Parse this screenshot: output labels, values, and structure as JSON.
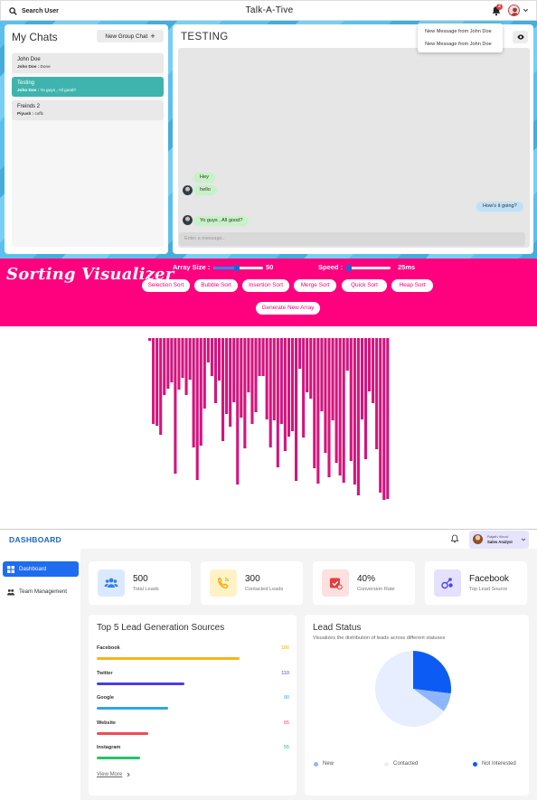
{
  "chat": {
    "search_label": "Search User",
    "app_title": "Talk-A-Tive",
    "notification_count": "2",
    "notifications": [
      "New Message from John Doe",
      "New Message from John Doe"
    ],
    "my_chats_title": "My Chats",
    "new_group_label": "New Group Chat",
    "chats": [
      {
        "name": "John Doe",
        "sender": "John Doe :",
        "last": " Done",
        "active": false
      },
      {
        "name": "Testing",
        "sender": "John Doe :",
        "last": " Yo guys , All good?",
        "active": true
      },
      {
        "name": "Freinds 2",
        "sender": "Piyush :",
        "last": " cxffc",
        "active": false
      }
    ],
    "active_chat_title": "TESTING",
    "messages": [
      {
        "text": "Hey",
        "side": "in"
      },
      {
        "text": "hello",
        "side": "in"
      },
      {
        "text": "How's it going?",
        "side": "out"
      },
      {
        "text": "Yo guys , All good?",
        "side": "in"
      }
    ],
    "input_placeholder": "Enter a message.."
  },
  "sorting": {
    "title": "Sorting Visualizer",
    "array_size_label": "Array Size :",
    "array_size_value": "50",
    "array_size_fraction": 0.47,
    "speed_label": "Speed :",
    "speed_value": "25ms",
    "speed_fraction": 0.05,
    "buttons": [
      "Selection Sort",
      "Bubble Sort",
      "Insertion Sort",
      "Merge Sort",
      "Quick Sort",
      "Heap Sort"
    ],
    "generate_label": "Generate New Array",
    "bar_color": "#d4147e",
    "bars": [
      3,
      95,
      97,
      107,
      63,
      56,
      49,
      150,
      57,
      44,
      63,
      46,
      121,
      157,
      119,
      78,
      27,
      42,
      72,
      47,
      114,
      84,
      98,
      71,
      162,
      88,
      122,
      60,
      95,
      82,
      42,
      42,
      90,
      121,
      91,
      143,
      95,
      125,
      109,
      103,
      158,
      34,
      110,
      60,
      67,
      144,
      161,
      81,
      127,
      154,
      91,
      138,
      152,
      160,
      36,
      136,
      162,
      174,
      90,
      134,
      59,
      72,
      123,
      171,
      179,
      178
    ]
  },
  "dashboard": {
    "logo": "DASHBOARD",
    "user_name": "Rajath Vinod",
    "user_role": "Sales Analyst",
    "sidebar": [
      {
        "label": "Dashboard",
        "icon": "grid-icon",
        "active": true
      },
      {
        "label": "Team Management",
        "icon": "team-icon",
        "active": false
      }
    ],
    "stats": [
      {
        "value": "500",
        "label": "Total Leads",
        "icon": "users-icon",
        "bg": "#dbe9ff",
        "fg": "#2f7ff0"
      },
      {
        "value": "300",
        "label": "Contacted Leads",
        "icon": "phone-icon",
        "bg": "#fff2c7",
        "fg": "#f2a900"
      },
      {
        "value": "40%",
        "label": "Conversion Rate",
        "icon": "conversion-icon",
        "bg": "#fde0e0",
        "fg": "#e53e3e"
      },
      {
        "value": "Facebook",
        "label": "Top Lead Source",
        "icon": "source-icon",
        "bg": "#e4e1ff",
        "fg": "#4f46e5"
      }
    ],
    "sources_title": "Top 5 Lead Generation Sources",
    "sources": [
      {
        "name": "Facebook",
        "value": 180,
        "color": "#f5b421"
      },
      {
        "name": "Twitter",
        "value": 110,
        "color": "#4a3fe0"
      },
      {
        "name": "Google",
        "value": 90,
        "color": "#2ea6e6"
      },
      {
        "name": "Website",
        "value": 65,
        "color": "#ef4c56"
      },
      {
        "name": "Instagram",
        "value": 55,
        "color": "#26c36b"
      }
    ],
    "sources_max": 180,
    "view_more": "View More",
    "status_title": "Lead Status",
    "status_subtitle": "Visualizes the distribution of leads across different statuses",
    "chart_data": {
      "type": "pie",
      "labels": [
        "Not Interested",
        "New",
        "Contacted"
      ],
      "values": [
        27,
        8,
        65
      ],
      "colors": [
        "#0d5bf5",
        "#8fb6fb",
        "#e6eeff"
      ],
      "legend_position": "bottom"
    },
    "legend": [
      {
        "label": "New",
        "color": "#8fb6fb"
      },
      {
        "label": "Contacted",
        "color": "#e6eeff"
      },
      {
        "label": "Not Interested",
        "color": "#0d5bf5"
      }
    ]
  }
}
